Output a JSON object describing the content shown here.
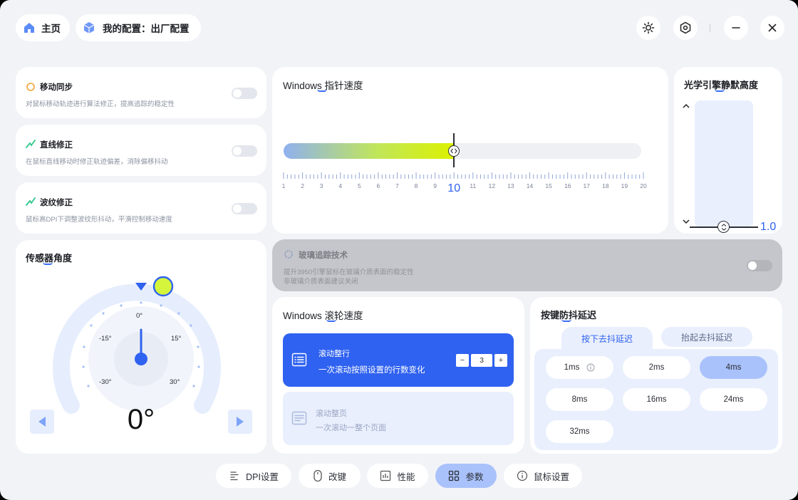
{
  "header": {
    "home_label": "主页",
    "config_label": "我的配置：出厂配置"
  },
  "features": [
    {
      "title": "移动同步",
      "desc": "对鼠标移动轨迹进行算法修正，提高追踪的稳定性",
      "icon": "circle-icon"
    },
    {
      "title": "直线修正",
      "desc": "在鼠标直线移动时修正轨迹偏差，消除偏移抖动",
      "icon": "zigzag-icon"
    },
    {
      "title": "波纹修正",
      "desc": "鼠标高DPI下调整波纹形抖动，平滑控制移动速度",
      "icon": "zigzag-icon"
    }
  ],
  "pointer_speed": {
    "title": "Windows 指针速度",
    "value": 10,
    "min": 1,
    "max": 20,
    "ticks": [
      "1",
      "2",
      "3",
      "4",
      "5",
      "6",
      "7",
      "8",
      "9",
      "10",
      "11",
      "12",
      "13",
      "14",
      "15",
      "16",
      "17",
      "18",
      "19",
      "20"
    ]
  },
  "lod": {
    "title": "光学引擎静默高度",
    "value": "1.0"
  },
  "sensor": {
    "title": "传感器角度",
    "value": "0°",
    "labels": {
      "top": "0°",
      "l15": "-15°",
      "r15": "15°",
      "l30": "-30°",
      "r30": "30°"
    }
  },
  "glass": {
    "title": "玻璃追踪技术",
    "desc1": "提升3950引擎鼠标在玻璃介质表面的稳定性",
    "desc2": "非玻璃介质表面建议关闭"
  },
  "scroll": {
    "title": "Windows 滚轮速度",
    "option1_title": "滚动整行",
    "option1_desc": "一次滚动按照设置的行数变化",
    "option2_title": "滚动整页",
    "option2_desc": "一次滚动一整个页面",
    "minus": "−",
    "plus": "+",
    "lines": "3"
  },
  "debounce": {
    "title": "按键防抖延迟",
    "tab_press": "按下去抖延迟",
    "tab_release": "抬起去抖延迟",
    "options": [
      "1ms",
      "2ms",
      "4ms",
      "8ms",
      "16ms",
      "24ms",
      "32ms"
    ],
    "selected": "4ms"
  },
  "nav": {
    "dpi": "DPI设置",
    "keys": "改键",
    "perf": "性能",
    "params": "参数",
    "mouse": "鼠标设置"
  },
  "colors": {
    "accent": "#2f62f0",
    "selected_soft": "#a9c2fb",
    "panel_soft": "#e9effd"
  }
}
